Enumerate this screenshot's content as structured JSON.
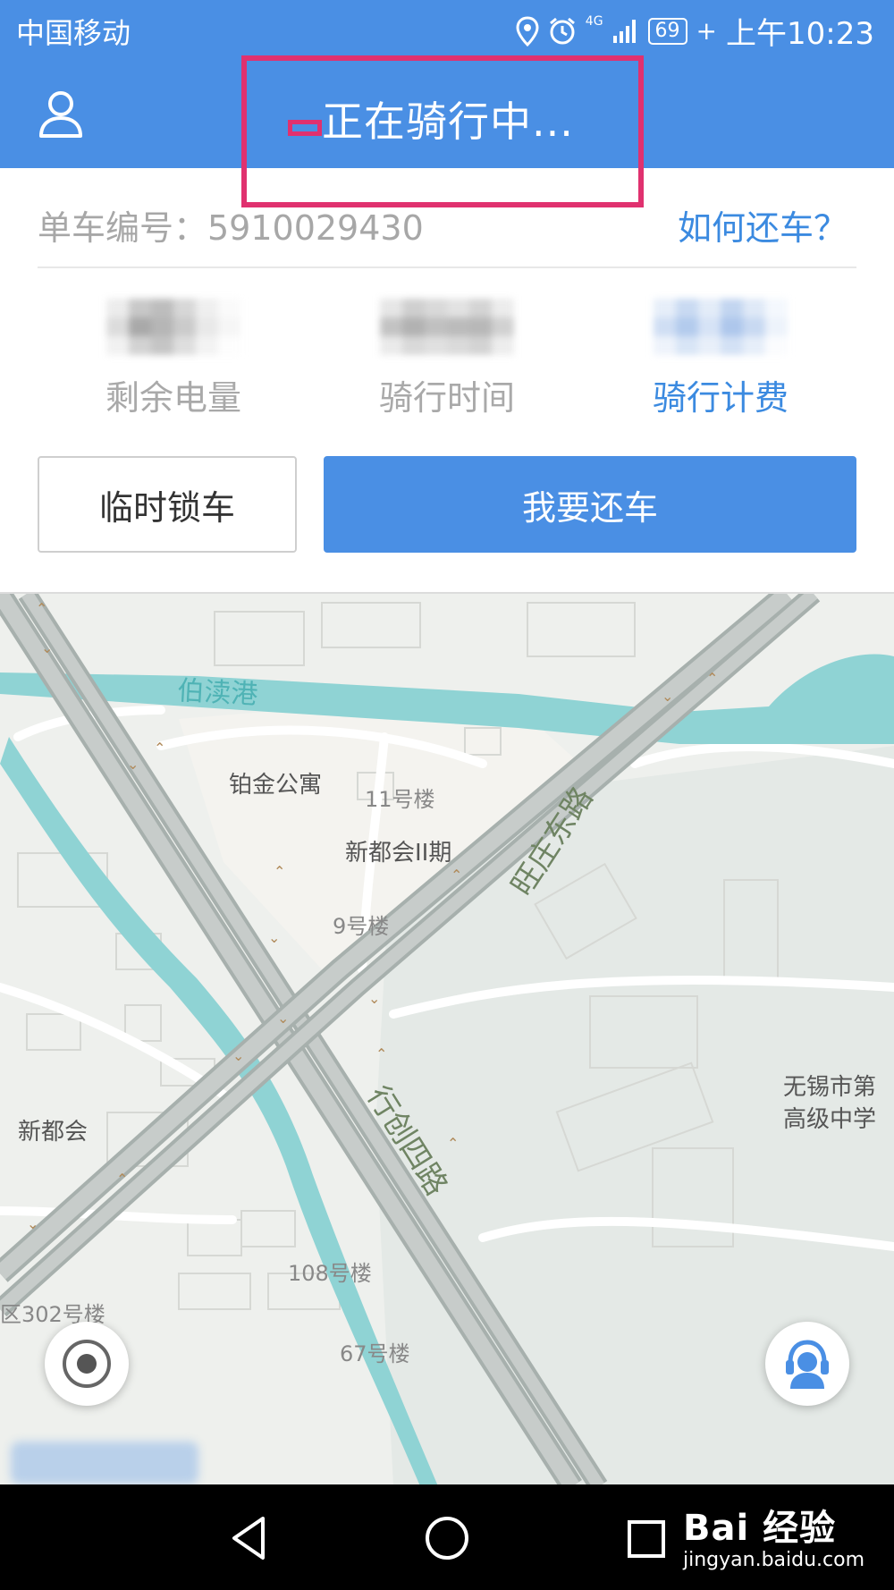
{
  "status_bar": {
    "carrier": "中国移动",
    "network": "4G",
    "battery": "69",
    "time": "上午10:23"
  },
  "header": {
    "title": "正在骑行中..."
  },
  "info": {
    "bike_label": "单车编号：5910029430",
    "how_to_return": "如何还车？",
    "stats": [
      {
        "label": "剩余电量"
      },
      {
        "label": "骑行时间"
      },
      {
        "label": "骑行计费"
      }
    ]
  },
  "actions": {
    "temp_lock": "临时锁车",
    "return_bike": "我要还车"
  },
  "map": {
    "labels": {
      "river": "伯渎港",
      "poi_1": "铂金公寓",
      "poi_2": "11号楼",
      "poi_3": "新都会II期",
      "poi_4": "9号楼",
      "road_1": "旺庄东路",
      "road_2": "行创四路",
      "poi_5": "新都会",
      "poi_6": "108号楼",
      "poi_7": "67号楼",
      "poi_8": "区302号楼",
      "school_1": "无锡市第",
      "school_2": "高级中学"
    }
  },
  "watermark": {
    "brand": "Bai  经验",
    "url": "jingyan.baidu.com"
  },
  "colors": {
    "primary": "#4a8fe4",
    "link": "#3b8ae0",
    "highlight": "#e0316f",
    "water": "#8fd3d4",
    "road": "#b9c1be"
  }
}
